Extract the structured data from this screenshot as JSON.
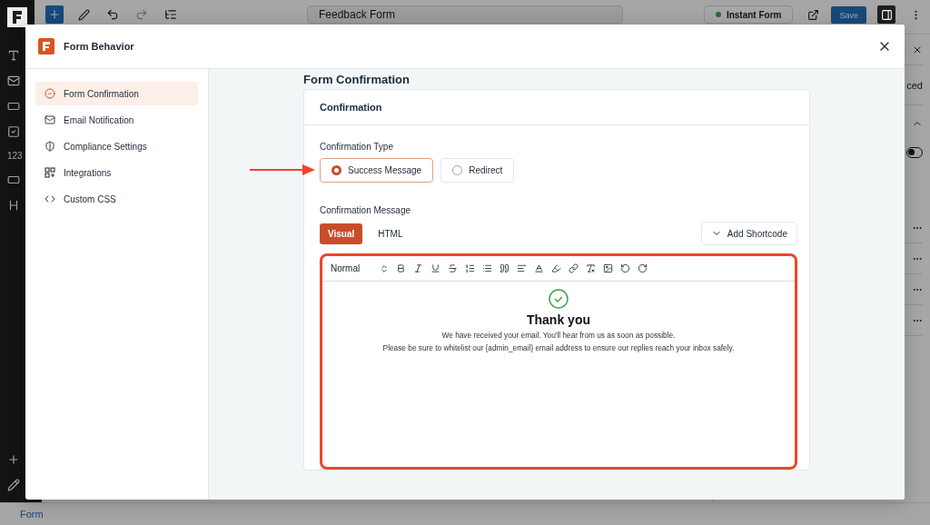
{
  "editor": {
    "title_field": "Feedback Form",
    "status_button": "Instant Form",
    "save_button": "Save",
    "side_label": "123",
    "panel_label": "ced",
    "toggle_on": false,
    "bottom_tab": "Form"
  },
  "modal": {
    "title": "Form Behavior",
    "nav": [
      {
        "label": "Form Confirmation",
        "selected": true
      },
      {
        "label": "Email Notification",
        "selected": false
      },
      {
        "label": "Compliance Settings",
        "selected": false
      },
      {
        "label": "Integrations",
        "selected": false
      },
      {
        "label": "Custom CSS",
        "selected": false
      }
    ],
    "section_title": "Form Confirmation",
    "card_title": "Confirmation",
    "type_label": "Confirmation Type",
    "types": [
      {
        "label": "Success Message",
        "selected": true
      },
      {
        "label": "Redirect",
        "selected": false
      }
    ],
    "message_label": "Confirmation Message",
    "editor_tabs": [
      {
        "label": "Visual",
        "selected": true
      },
      {
        "label": "HTML",
        "selected": false
      }
    ],
    "shortcode_button": "Add Shortcode",
    "format_select": "Normal",
    "message": {
      "heading": "Thank you",
      "lines": [
        "We have received your email. You'll hear from us as soon as possible.",
        "Please be sure to whitelist our {admin_email} email address to ensure our replies reach your inbox safely."
      ]
    }
  }
}
